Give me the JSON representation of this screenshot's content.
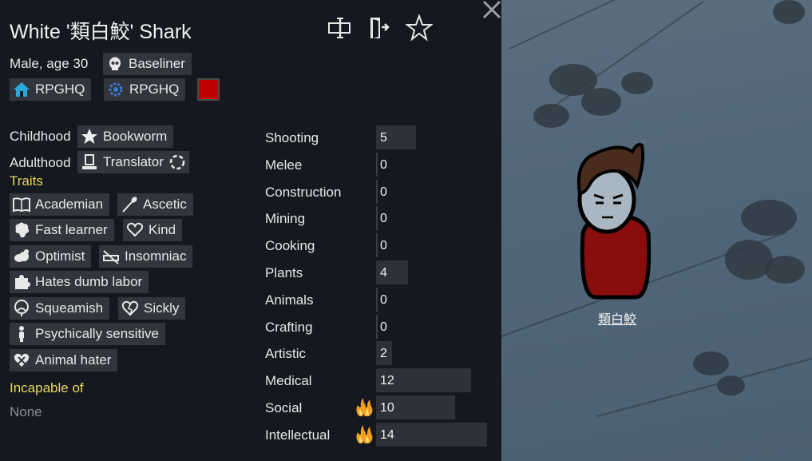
{
  "header": {
    "title": "White '類白鮫' Shark"
  },
  "bio": {
    "gender_age": "Male, age 30",
    "xenotype": "Baseliner",
    "faction": "RPGHQ",
    "ideo": "RPGHQ",
    "favorite_color": "#c00000"
  },
  "backstory": {
    "childhood_label": "Childhood",
    "childhood": "Bookworm",
    "adulthood_label": "Adulthood",
    "adulthood": "Translator"
  },
  "traits": {
    "label": "Traits",
    "items": [
      "Academian",
      "Ascetic",
      "Fast learner",
      "Kind",
      "Optimist",
      "Insomniac",
      "Hates dumb labor",
      "Squeamish",
      "Sickly",
      "Psychically sensitive",
      "Animal hater"
    ]
  },
  "incapable": {
    "label": "Incapable of",
    "value": "None"
  },
  "skills": [
    {
      "name": "Shooting",
      "level": 5,
      "passion": 0
    },
    {
      "name": "Melee",
      "level": 0,
      "passion": 0
    },
    {
      "name": "Construction",
      "level": 0,
      "passion": 0
    },
    {
      "name": "Mining",
      "level": 0,
      "passion": 0
    },
    {
      "name": "Cooking",
      "level": 0,
      "passion": 0
    },
    {
      "name": "Plants",
      "level": 4,
      "passion": 0
    },
    {
      "name": "Animals",
      "level": 0,
      "passion": 0
    },
    {
      "name": "Crafting",
      "level": 0,
      "passion": 0
    },
    {
      "name": "Artistic",
      "level": 2,
      "passion": 0
    },
    {
      "name": "Medical",
      "level": 12,
      "passion": 0
    },
    {
      "name": "Social",
      "level": 10,
      "passion": 2
    },
    {
      "name": "Intellectual",
      "level": 14,
      "passion": 2
    }
  ],
  "map": {
    "pawn_label": "類白鮫"
  },
  "colors": {
    "panel_bg": "#15191f",
    "chip_bg": "#32363c",
    "accent_yellow": "#e6d65a",
    "flame": "#f0a020"
  }
}
